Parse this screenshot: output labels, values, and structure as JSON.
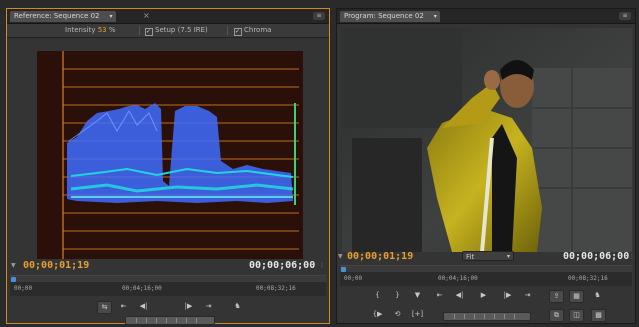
{
  "reference_monitor": {
    "tab_label": "Reference: Sequence 02",
    "intensity_label": "Intensity",
    "intensity_value": "53",
    "intensity_unit": "%",
    "setup_label": "Setup (7.5 IRE)",
    "chroma_label": "Chroma",
    "current_timecode": "00;00;01;19",
    "duration_timecode": "00;00;06;00",
    "ruler_labels": [
      "00;00",
      "00;04;16;00",
      "00;08;32;16"
    ],
    "playhead_position": 0.0
  },
  "program_monitor": {
    "tab_label": "Program: Sequence 02",
    "current_timecode": "00;00;01;19",
    "duration_timecode": "00;00;06;00",
    "zoom_value": "Fit",
    "ruler_labels": [
      "00;00",
      "00;04;16;00",
      "00;08;32;16"
    ],
    "playhead_position": 0.0
  },
  "colors": {
    "accent": "#e8a02c",
    "scope_bg": "#2a1008",
    "scope_grid": "#d9801f",
    "waveform": "#3f6cff",
    "waveform_chroma": "#22d3e0",
    "playhead": "#4a8fd9"
  },
  "icons": {
    "close": "×",
    "dropdown": "▾",
    "panel_menu": "≡",
    "step_back": "◀|",
    "step_forward": "|▶",
    "play": "▶"
  }
}
